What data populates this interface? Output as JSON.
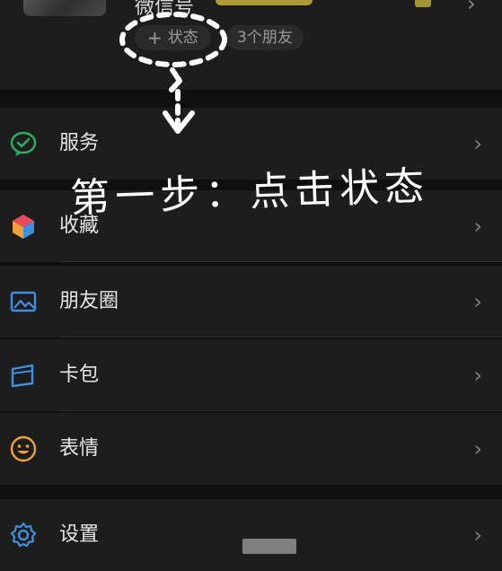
{
  "profile": {
    "wechat_id_label": "微信号",
    "status_button": "状态",
    "status_plus": "+",
    "friends_count_label": "3个朋友"
  },
  "menu": [
    {
      "label": "服务",
      "icon": "wechat-pay-icon"
    },
    {
      "label": "收藏",
      "icon": "favorites-cube-icon"
    },
    {
      "label": "朋友圈",
      "icon": "moments-picture-icon"
    },
    {
      "label": "卡包",
      "icon": "card-wallet-icon"
    },
    {
      "label": "表情",
      "icon": "emoji-smile-icon"
    },
    {
      "label": "设置",
      "icon": "settings-gear-icon"
    }
  ],
  "annotation": {
    "instruction": "第一步：点击状态"
  },
  "colors": {
    "background": "#0f0f0f",
    "row": "#1d1d1d",
    "green": "#2aae67",
    "blue": "#3e8fe0",
    "orange": "#f0a23a"
  }
}
